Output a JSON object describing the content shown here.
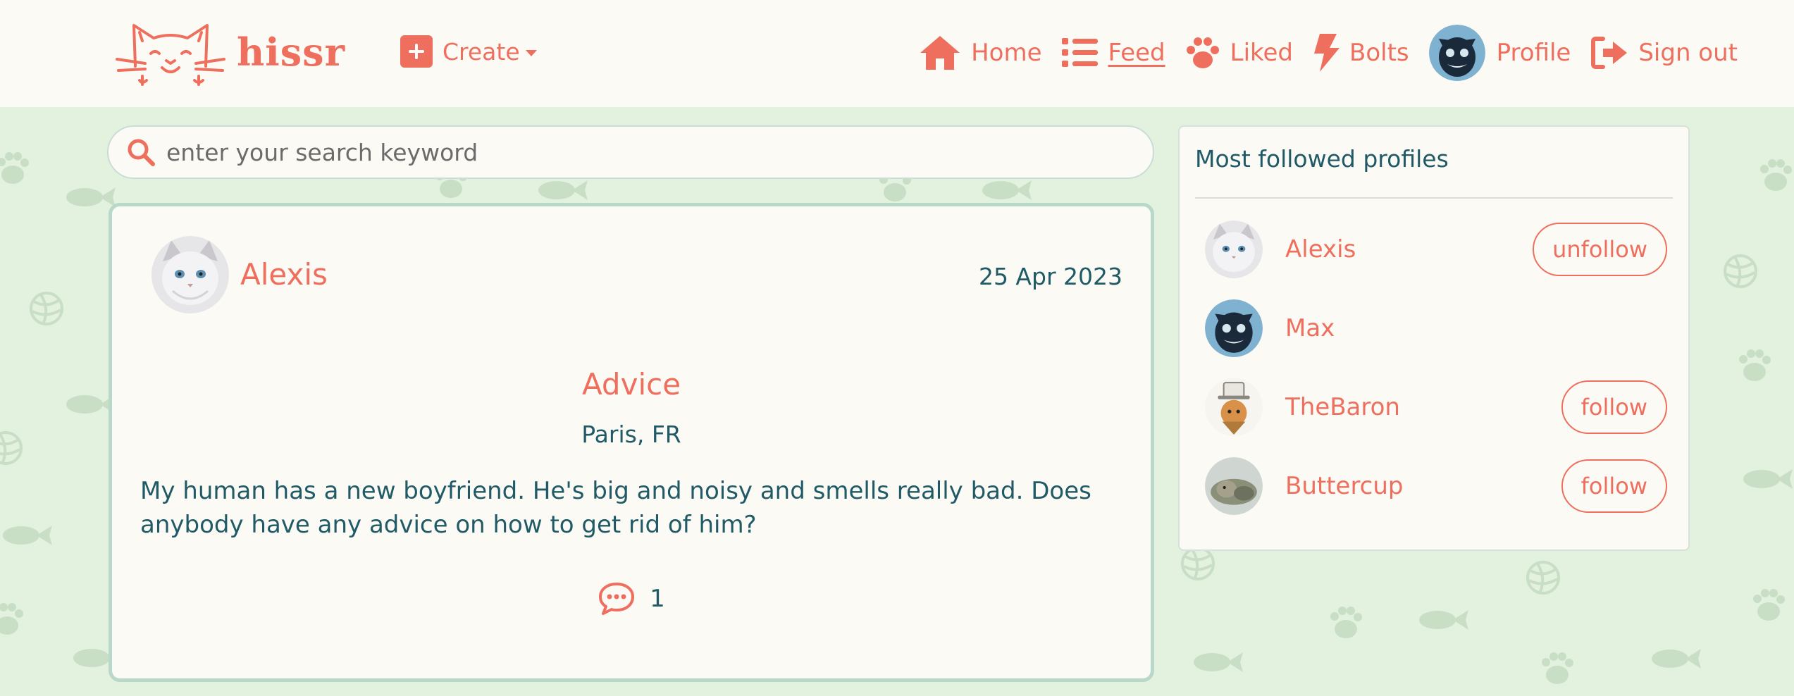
{
  "brand": {
    "name": "hissr"
  },
  "colors": {
    "accent": "#ef6f5e",
    "text": "#1f5a66",
    "background": "#e3f1df",
    "surface": "#fcfaf5"
  },
  "nav": {
    "create_label": "Create",
    "items": [
      {
        "label": "Home",
        "icon": "home-icon"
      },
      {
        "label": "Feed",
        "icon": "list-icon",
        "active": true
      },
      {
        "label": "Liked",
        "icon": "paw-icon"
      },
      {
        "label": "Bolts",
        "icon": "bolt-icon"
      },
      {
        "label": "Profile",
        "icon": "avatar"
      },
      {
        "label": "Sign out",
        "icon": "sign-out-icon"
      }
    ]
  },
  "search": {
    "placeholder": "enter your search keyword"
  },
  "post": {
    "author": "Alexis",
    "date": "25 Apr 2023",
    "title": "Advice",
    "location": "Paris, FR",
    "body": "My human has a new boyfriend. He's big and noisy and smells really bad. Does anybody have any advice on how to get rid of him?",
    "comment_count": "1"
  },
  "sidebar": {
    "title": "Most followed profiles",
    "profiles": [
      {
        "name": "Alexis",
        "action": "unfollow"
      },
      {
        "name": "Max",
        "action": ""
      },
      {
        "name": "TheBaron",
        "action": "follow"
      },
      {
        "name": "Buttercup",
        "action": "follow"
      }
    ]
  }
}
